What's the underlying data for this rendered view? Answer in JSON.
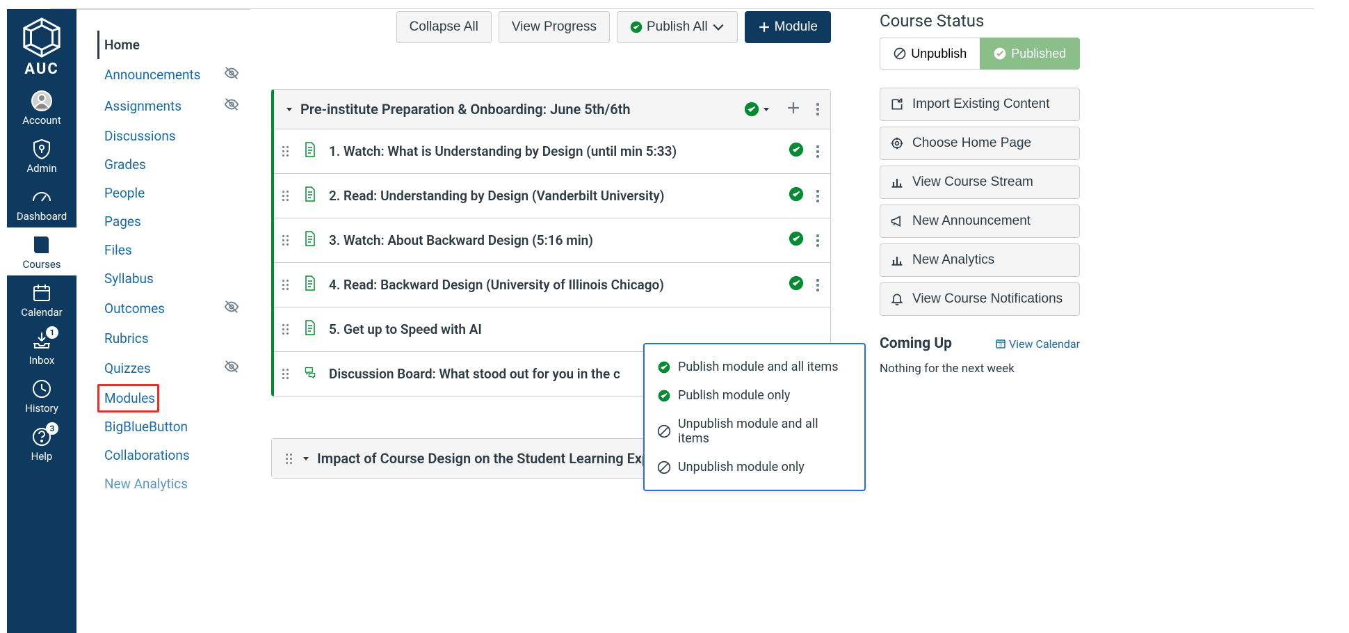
{
  "global_nav": {
    "brand_text": "AUC",
    "items": [
      {
        "key": "account",
        "label": "Account",
        "icon": "user-circle"
      },
      {
        "key": "admin",
        "label": "Admin",
        "icon": "shield"
      },
      {
        "key": "dashboard",
        "label": "Dashboard",
        "icon": "gauge"
      },
      {
        "key": "courses",
        "label": "Courses",
        "icon": "book"
      },
      {
        "key": "calendar",
        "label": "Calendar",
        "icon": "calendar"
      },
      {
        "key": "inbox",
        "label": "Inbox",
        "icon": "inbox",
        "badge": "1"
      },
      {
        "key": "history",
        "label": "History",
        "icon": "clock"
      },
      {
        "key": "help",
        "label": "Help",
        "icon": "question",
        "badge": "3"
      }
    ],
    "active": "courses"
  },
  "course_nav": {
    "items": [
      {
        "label": "Home",
        "hidden": false,
        "active": true
      },
      {
        "label": "Announcements",
        "hidden": true
      },
      {
        "label": "Assignments",
        "hidden": true
      },
      {
        "label": "Discussions",
        "hidden": false
      },
      {
        "label": "Grades",
        "hidden": false
      },
      {
        "label": "People",
        "hidden": false
      },
      {
        "label": "Pages",
        "hidden": false
      },
      {
        "label": "Files",
        "hidden": false
      },
      {
        "label": "Syllabus",
        "hidden": false
      },
      {
        "label": "Outcomes",
        "hidden": true
      },
      {
        "label": "Rubrics",
        "hidden": false
      },
      {
        "label": "Quizzes",
        "hidden": true
      },
      {
        "label": "Modules",
        "hidden": false,
        "highlighted": true
      },
      {
        "label": "BigBlueButton",
        "hidden": false
      },
      {
        "label": "Collaborations",
        "hidden": false
      },
      {
        "label": "New Analytics",
        "hidden": false,
        "cutoff": true
      }
    ]
  },
  "toolbar": {
    "collapse_all": "Collapse All",
    "view_progress": "View Progress",
    "publish_all": "Publish All",
    "add_module": "Module"
  },
  "modules": [
    {
      "title": "Pre-institute Preparation & Onboarding: June 5th/6th",
      "published_all": true,
      "items": [
        {
          "type": "page",
          "title": "1. Watch: What is Understanding by Design (until min 5:33)",
          "published": true
        },
        {
          "type": "page",
          "title": "2. Read: Understanding by Design (Vanderbilt University)",
          "published": true
        },
        {
          "type": "page",
          "title": "3. Watch: About Backward Design (5:16 min)",
          "published": true
        },
        {
          "type": "page",
          "title": "4. Read: Backward Design (University of Illinois Chicago)",
          "published": true
        },
        {
          "type": "page",
          "title": "5. Get up to Speed with AI",
          "published": true
        },
        {
          "type": "discussion",
          "title": "Discussion Board: What stood out for you in the c",
          "published": true
        }
      ]
    },
    {
      "title": "Impact of Course Design on the Student Learning Exp",
      "published_all": false,
      "items": []
    }
  ],
  "publish_menu": {
    "opt1": "Publish module and all items",
    "opt2": "Publish module only",
    "opt3": "Unpublish module and all items",
    "opt4": "Unpublish module only"
  },
  "sidebar": {
    "course_status": "Course Status",
    "unpublish": "Unpublish",
    "published": "Published",
    "actions": [
      {
        "icon": "import",
        "label": "Import Existing Content"
      },
      {
        "icon": "target",
        "label": "Choose Home Page"
      },
      {
        "icon": "bar",
        "label": "View Course Stream"
      },
      {
        "icon": "megaphone",
        "label": "New Announcement"
      },
      {
        "icon": "bar",
        "label": "New Analytics"
      },
      {
        "icon": "bell",
        "label": "View Course Notifications"
      }
    ],
    "coming_up": "Coming Up",
    "view_calendar": "View Calendar",
    "nothing": "Nothing for the next week"
  }
}
